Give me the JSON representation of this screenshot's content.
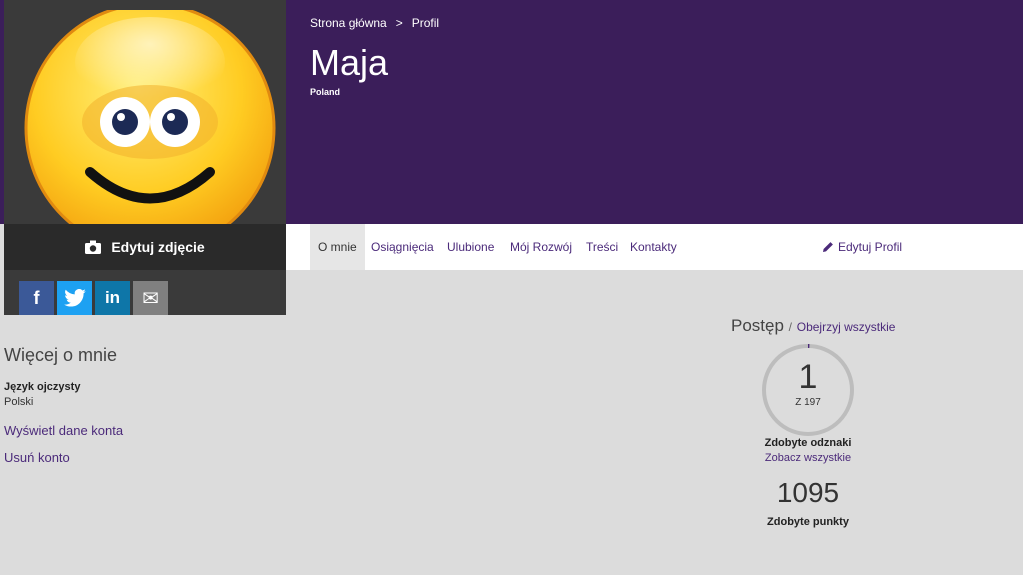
{
  "breadcrumb": {
    "home": "Strona główna",
    "separator": ">",
    "current": "Profil"
  },
  "profile": {
    "name": "Maja",
    "country": "Poland"
  },
  "avatar": {
    "icon": "smiley-face",
    "edit_label": "Edytuj zdjęcie"
  },
  "social": [
    {
      "icon": "facebook-icon",
      "glyph": "f",
      "color": "#3b5998"
    },
    {
      "icon": "twitter-icon",
      "glyph": "t",
      "color": "#1da1f2"
    },
    {
      "icon": "linkedin-icon",
      "glyph": "in",
      "color": "#0e76a8"
    },
    {
      "icon": "mail-icon",
      "glyph": "✉",
      "color": "#808080"
    }
  ],
  "tabs": [
    {
      "label": "O mnie",
      "active": true
    },
    {
      "label": "Osiągnięcia"
    },
    {
      "label": "Ulubione"
    },
    {
      "label": "Mój Rozwój"
    },
    {
      "label": "Treści"
    },
    {
      "label": "Kontakty"
    }
  ],
  "edit_profile_label": "Edytuj Profil",
  "about": {
    "title": "Więcej o mnie",
    "native_language_label": "Język ojczysty",
    "native_language_value": "Polski",
    "view_account_link": "Wyświetl dane konta",
    "delete_account_link": "Usuń konto"
  },
  "progress": {
    "title": "Postęp",
    "separator": "/",
    "view_all": "Obejrzyj wszystkie",
    "badges_earned": "1",
    "badges_total_label": "Z 197",
    "badges_fraction": 0.005,
    "badges_label": "Zdobyte odznaki",
    "see_all": "Zobacz wszystkie",
    "points": "1095",
    "points_label": "Zdobyte punkty"
  },
  "colors": {
    "header": "#3b1e5a",
    "accent": "#4b2a7a",
    "background": "#dcdcdc"
  }
}
